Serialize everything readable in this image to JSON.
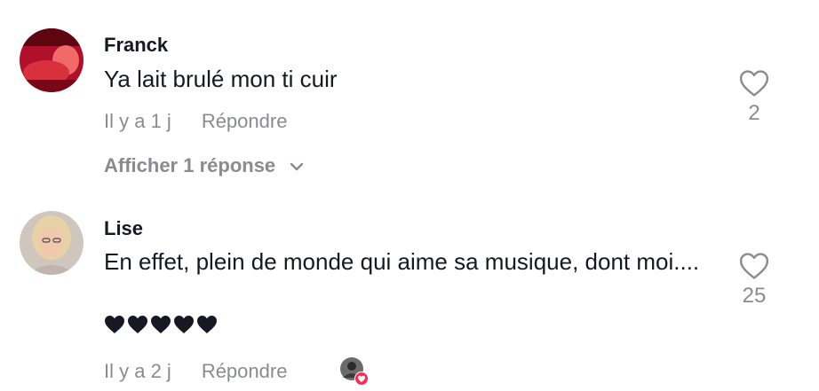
{
  "comments": [
    {
      "author": "Franck",
      "text": "Ya lait brulé mon ti cuir",
      "time": "Il y a 1 j",
      "reply_label": "Répondre",
      "like_count": "2",
      "view_replies": "Afficher 1 réponse"
    },
    {
      "author": "Lise",
      "text": "En effet, plein de monde qui aime sa musique, dont moi....",
      "emoji_line": "❤❤❤❤❤",
      "time": "Il y a 2 j",
      "reply_label": "Répondre",
      "like_count": "25"
    }
  ],
  "colors": {
    "text": "#161823",
    "muted": "#8a8b91",
    "heart_badge": "#fe2c55"
  },
  "icons": {
    "like": "heart-outline-icon",
    "expand": "chevron-down-icon",
    "liked_by_creator": "heart-badge-icon"
  }
}
